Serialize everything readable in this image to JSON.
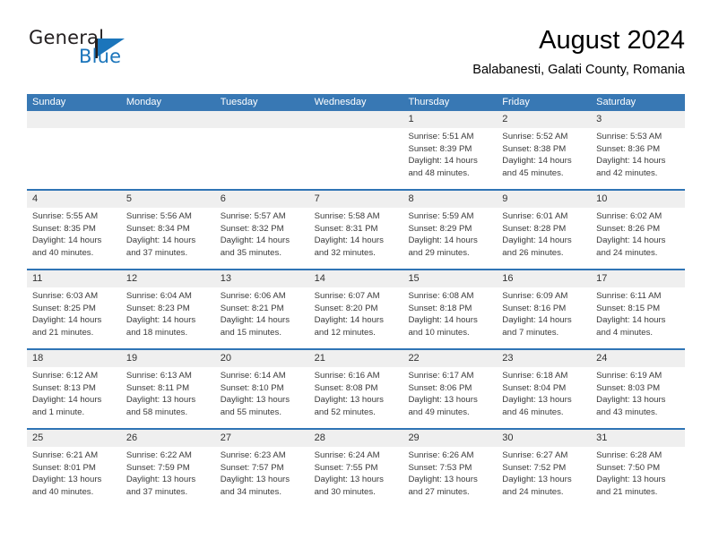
{
  "brand": {
    "name_part1": "General",
    "name_part2": "Blue",
    "flag_icon": "blue-triangle-flag",
    "accent_color": "#1b75bb"
  },
  "header": {
    "title": "August 2024",
    "subtitle": "Balabanesti, Galati County, Romania"
  },
  "colors": {
    "header_blue": "#3878b4",
    "row_rule_blue": "#2f74b5",
    "daynum_band": "#efefef"
  },
  "calendar": {
    "weekdays": [
      "Sunday",
      "Monday",
      "Tuesday",
      "Wednesday",
      "Thursday",
      "Friday",
      "Saturday"
    ],
    "weeks": [
      [
        {
          "day": "",
          "lines": []
        },
        {
          "day": "",
          "lines": []
        },
        {
          "day": "",
          "lines": []
        },
        {
          "day": "",
          "lines": []
        },
        {
          "day": "1",
          "lines": [
            "Sunrise: 5:51 AM",
            "Sunset: 8:39 PM",
            "Daylight: 14 hours",
            "and 48 minutes."
          ]
        },
        {
          "day": "2",
          "lines": [
            "Sunrise: 5:52 AM",
            "Sunset: 8:38 PM",
            "Daylight: 14 hours",
            "and 45 minutes."
          ]
        },
        {
          "day": "3",
          "lines": [
            "Sunrise: 5:53 AM",
            "Sunset: 8:36 PM",
            "Daylight: 14 hours",
            "and 42 minutes."
          ]
        }
      ],
      [
        {
          "day": "4",
          "lines": [
            "Sunrise: 5:55 AM",
            "Sunset: 8:35 PM",
            "Daylight: 14 hours",
            "and 40 minutes."
          ]
        },
        {
          "day": "5",
          "lines": [
            "Sunrise: 5:56 AM",
            "Sunset: 8:34 PM",
            "Daylight: 14 hours",
            "and 37 minutes."
          ]
        },
        {
          "day": "6",
          "lines": [
            "Sunrise: 5:57 AM",
            "Sunset: 8:32 PM",
            "Daylight: 14 hours",
            "and 35 minutes."
          ]
        },
        {
          "day": "7",
          "lines": [
            "Sunrise: 5:58 AM",
            "Sunset: 8:31 PM",
            "Daylight: 14 hours",
            "and 32 minutes."
          ]
        },
        {
          "day": "8",
          "lines": [
            "Sunrise: 5:59 AM",
            "Sunset: 8:29 PM",
            "Daylight: 14 hours",
            "and 29 minutes."
          ]
        },
        {
          "day": "9",
          "lines": [
            "Sunrise: 6:01 AM",
            "Sunset: 8:28 PM",
            "Daylight: 14 hours",
            "and 26 minutes."
          ]
        },
        {
          "day": "10",
          "lines": [
            "Sunrise: 6:02 AM",
            "Sunset: 8:26 PM",
            "Daylight: 14 hours",
            "and 24 minutes."
          ]
        }
      ],
      [
        {
          "day": "11",
          "lines": [
            "Sunrise: 6:03 AM",
            "Sunset: 8:25 PM",
            "Daylight: 14 hours",
            "and 21 minutes."
          ]
        },
        {
          "day": "12",
          "lines": [
            "Sunrise: 6:04 AM",
            "Sunset: 8:23 PM",
            "Daylight: 14 hours",
            "and 18 minutes."
          ]
        },
        {
          "day": "13",
          "lines": [
            "Sunrise: 6:06 AM",
            "Sunset: 8:21 PM",
            "Daylight: 14 hours",
            "and 15 minutes."
          ]
        },
        {
          "day": "14",
          "lines": [
            "Sunrise: 6:07 AM",
            "Sunset: 8:20 PM",
            "Daylight: 14 hours",
            "and 12 minutes."
          ]
        },
        {
          "day": "15",
          "lines": [
            "Sunrise: 6:08 AM",
            "Sunset: 8:18 PM",
            "Daylight: 14 hours",
            "and 10 minutes."
          ]
        },
        {
          "day": "16",
          "lines": [
            "Sunrise: 6:09 AM",
            "Sunset: 8:16 PM",
            "Daylight: 14 hours",
            "and 7 minutes."
          ]
        },
        {
          "day": "17",
          "lines": [
            "Sunrise: 6:11 AM",
            "Sunset: 8:15 PM",
            "Daylight: 14 hours",
            "and 4 minutes."
          ]
        }
      ],
      [
        {
          "day": "18",
          "lines": [
            "Sunrise: 6:12 AM",
            "Sunset: 8:13 PM",
            "Daylight: 14 hours",
            "and 1 minute."
          ]
        },
        {
          "day": "19",
          "lines": [
            "Sunrise: 6:13 AM",
            "Sunset: 8:11 PM",
            "Daylight: 13 hours",
            "and 58 minutes."
          ]
        },
        {
          "day": "20",
          "lines": [
            "Sunrise: 6:14 AM",
            "Sunset: 8:10 PM",
            "Daylight: 13 hours",
            "and 55 minutes."
          ]
        },
        {
          "day": "21",
          "lines": [
            "Sunrise: 6:16 AM",
            "Sunset: 8:08 PM",
            "Daylight: 13 hours",
            "and 52 minutes."
          ]
        },
        {
          "day": "22",
          "lines": [
            "Sunrise: 6:17 AM",
            "Sunset: 8:06 PM",
            "Daylight: 13 hours",
            "and 49 minutes."
          ]
        },
        {
          "day": "23",
          "lines": [
            "Sunrise: 6:18 AM",
            "Sunset: 8:04 PM",
            "Daylight: 13 hours",
            "and 46 minutes."
          ]
        },
        {
          "day": "24",
          "lines": [
            "Sunrise: 6:19 AM",
            "Sunset: 8:03 PM",
            "Daylight: 13 hours",
            "and 43 minutes."
          ]
        }
      ],
      [
        {
          "day": "25",
          "lines": [
            "Sunrise: 6:21 AM",
            "Sunset: 8:01 PM",
            "Daylight: 13 hours",
            "and 40 minutes."
          ]
        },
        {
          "day": "26",
          "lines": [
            "Sunrise: 6:22 AM",
            "Sunset: 7:59 PM",
            "Daylight: 13 hours",
            "and 37 minutes."
          ]
        },
        {
          "day": "27",
          "lines": [
            "Sunrise: 6:23 AM",
            "Sunset: 7:57 PM",
            "Daylight: 13 hours",
            "and 34 minutes."
          ]
        },
        {
          "day": "28",
          "lines": [
            "Sunrise: 6:24 AM",
            "Sunset: 7:55 PM",
            "Daylight: 13 hours",
            "and 30 minutes."
          ]
        },
        {
          "day": "29",
          "lines": [
            "Sunrise: 6:26 AM",
            "Sunset: 7:53 PM",
            "Daylight: 13 hours",
            "and 27 minutes."
          ]
        },
        {
          "day": "30",
          "lines": [
            "Sunrise: 6:27 AM",
            "Sunset: 7:52 PM",
            "Daylight: 13 hours",
            "and 24 minutes."
          ]
        },
        {
          "day": "31",
          "lines": [
            "Sunrise: 6:28 AM",
            "Sunset: 7:50 PM",
            "Daylight: 13 hours",
            "and 21 minutes."
          ]
        }
      ]
    ]
  }
}
